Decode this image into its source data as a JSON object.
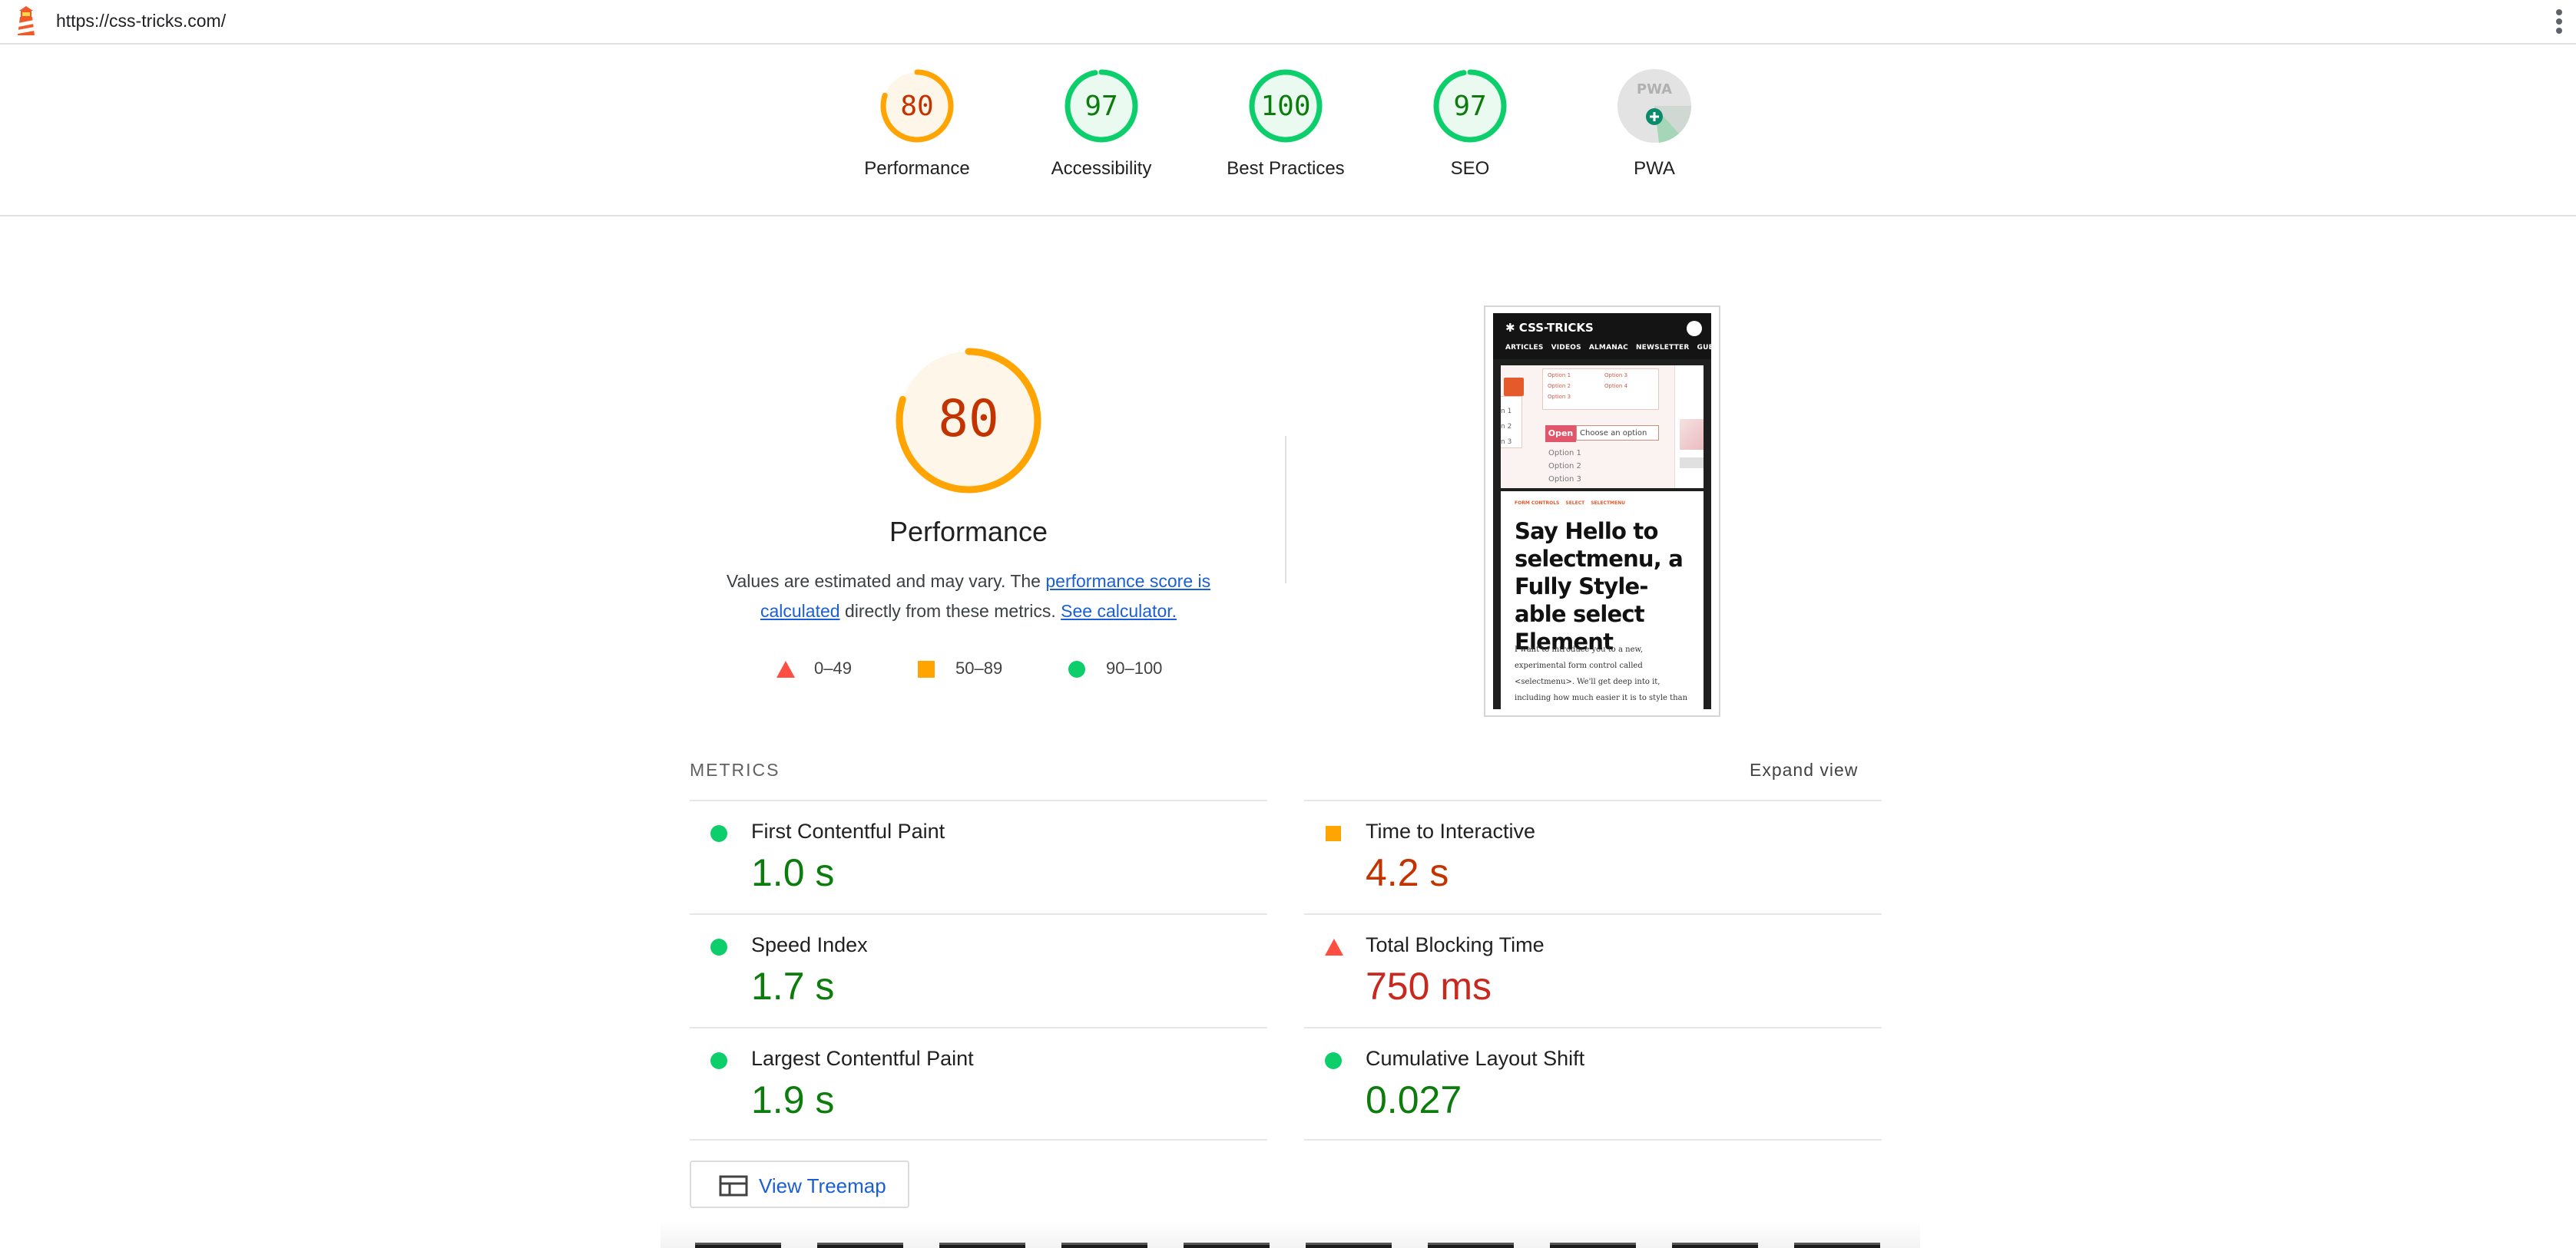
{
  "url_bar": {
    "url": "https://css-tricks.com/"
  },
  "colors": {
    "pass": "#0cce6b",
    "average": "#ffa400",
    "fail": "#ff4e42",
    "link": "#1a5fd6"
  },
  "categories": [
    {
      "label": "Performance",
      "score": "80",
      "status": "average"
    },
    {
      "label": "Accessibility",
      "score": "97",
      "status": "pass"
    },
    {
      "label": "Best Practices",
      "score": "100",
      "status": "pass"
    },
    {
      "label": "SEO",
      "score": "97",
      "status": "pass"
    },
    {
      "label": "PWA",
      "score": "",
      "status": "pwa"
    }
  ],
  "performance": {
    "score": "80",
    "title": "Performance",
    "desc_before": "Values are estimated and may vary. The ",
    "link_score": "performance score is calculated",
    "desc_middle": " directly from these metrics. ",
    "link_calculator": "See calculator.",
    "legend": [
      {
        "icon": "fail-triangle-icon",
        "range": "0–49"
      },
      {
        "icon": "average-square-icon",
        "range": "50–89"
      },
      {
        "icon": "pass-circle-icon",
        "range": "90–100"
      }
    ]
  },
  "screenshot": {
    "logo": "✱ CSS-TRICKS",
    "nav": [
      "ARTICLES",
      "VIDEOS",
      "ALMANAC",
      "NEWSLETTER",
      "GUE"
    ],
    "popup_options": [
      "Option 1",
      "Option 2",
      "Option 3",
      "Option 3",
      "Option 4"
    ],
    "left_options": [
      "n 1",
      "n 2",
      "n 3"
    ],
    "open_label": "Open",
    "choose_label": "Choose an option",
    "options": [
      "Option 1",
      "Option 2",
      "Option 3"
    ],
    "tags": [
      "FORM CONTROLS",
      "SELECT",
      "SELECTMENU"
    ],
    "headline": "Say Hello to selectmenu, a Fully Style-able select Element",
    "body": "I want to introduce you to a new, experimental form control called <selectmenu>. We'll get deep into it, including how much easier it is to style than"
  },
  "metrics": {
    "heading": "METRICS",
    "expand": "Expand view",
    "left": [
      {
        "title": "First Contentful Paint",
        "value": "1.0 s",
        "status": "pass"
      },
      {
        "title": "Speed Index",
        "value": "1.7 s",
        "status": "pass"
      },
      {
        "title": "Largest Contentful Paint",
        "value": "1.9 s",
        "status": "pass"
      }
    ],
    "right": [
      {
        "title": "Time to Interactive",
        "value": "4.2 s",
        "status": "average"
      },
      {
        "title": "Total Blocking Time",
        "value": "750 ms",
        "status": "fail"
      },
      {
        "title": "Cumulative Layout Shift",
        "value": "0.027",
        "status": "pass"
      }
    ]
  },
  "treemap": {
    "label": "View Treemap"
  }
}
